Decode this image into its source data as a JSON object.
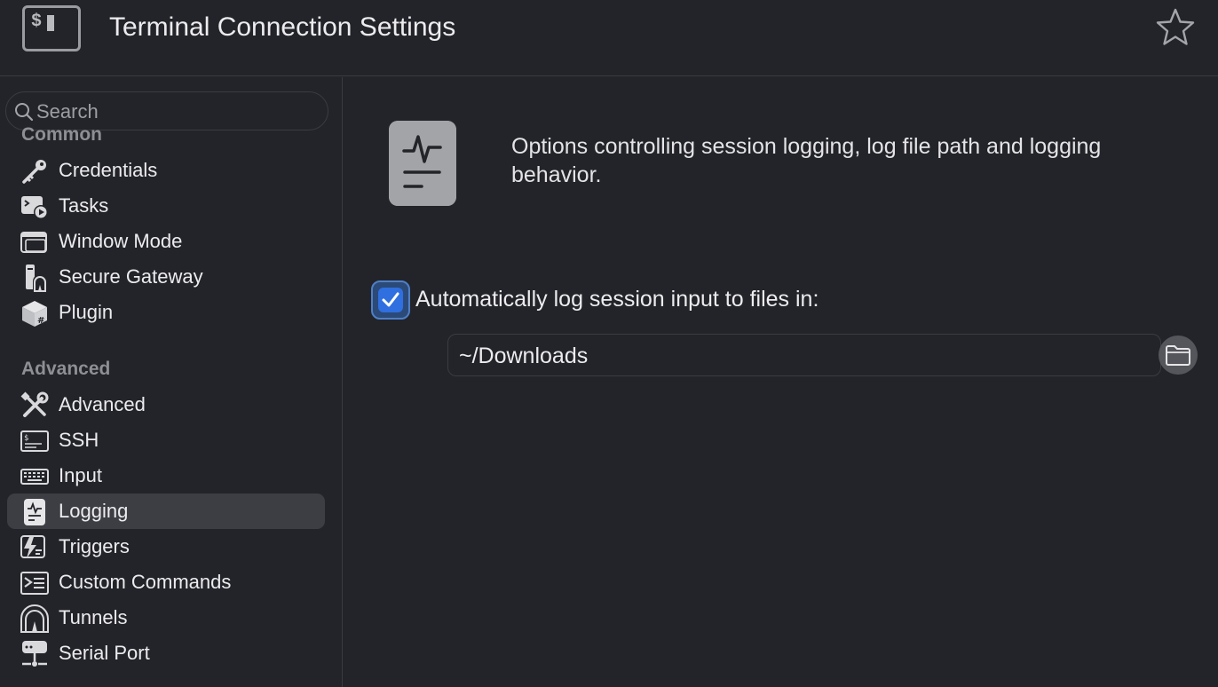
{
  "header": {
    "title": "Terminal Connection Settings",
    "app_icon": "terminal-icon",
    "app_icon_text": "$",
    "favorite_icon": "star-icon"
  },
  "sidebar": {
    "search_placeholder": "Search",
    "sections": [
      {
        "label": "Common",
        "items": [
          {
            "label": "Credentials",
            "icon": "key-icon"
          },
          {
            "label": "Tasks",
            "icon": "tasks-icon"
          },
          {
            "label": "Window Mode",
            "icon": "window-mode-icon"
          },
          {
            "label": "Secure Gateway",
            "icon": "secure-gateway-icon"
          },
          {
            "label": "Plugin",
            "icon": "plugin-icon"
          }
        ]
      },
      {
        "label": "Advanced",
        "items": [
          {
            "label": "Advanced",
            "icon": "tools-icon"
          },
          {
            "label": "SSH",
            "icon": "ssh-icon"
          },
          {
            "label": "Input",
            "icon": "keyboard-icon"
          },
          {
            "label": "Logging",
            "icon": "logging-icon",
            "selected": true
          },
          {
            "label": "Triggers",
            "icon": "triggers-icon"
          },
          {
            "label": "Custom Commands",
            "icon": "custom-commands-icon"
          },
          {
            "label": "Tunnels",
            "icon": "tunnels-icon"
          },
          {
            "label": "Serial Port",
            "icon": "serial-port-icon"
          }
        ]
      }
    ]
  },
  "main": {
    "section_icon": "log-document-icon",
    "description": "Options controlling session logging, log file path and logging behavior.",
    "auto_log": {
      "label": "Automatically log session input to files in:",
      "checked": true
    },
    "path": {
      "value": "~/Downloads",
      "browse_icon": "folder-icon"
    }
  },
  "colors": {
    "background": "#232429",
    "selected": "#3d3e44",
    "accent": "#2f6fe0",
    "text": "#ececee",
    "muted": "#8e8f94"
  }
}
